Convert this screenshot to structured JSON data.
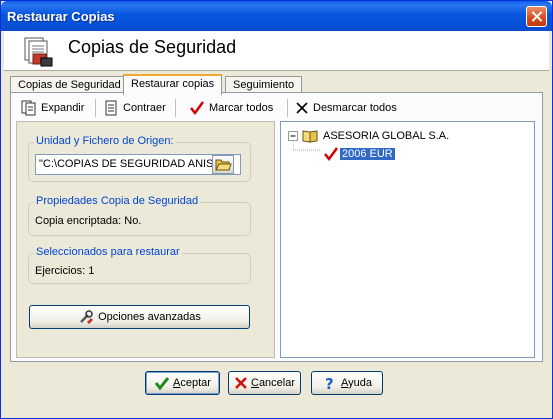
{
  "window": {
    "title": "Restaurar Copias"
  },
  "header": {
    "title": "Copias de Seguridad"
  },
  "tabs": [
    {
      "label": "Copias de Seguridad",
      "active": false
    },
    {
      "label": "Restaurar copias",
      "active": true
    },
    {
      "label": "Seguimiento",
      "active": false
    }
  ],
  "toolbar": {
    "expand": "Expandir",
    "collapse": "Contraer",
    "check_all": "Marcar todos",
    "uncheck_all": "Desmarcar todos"
  },
  "origin": {
    "label": "Unidad y Fichero de Origen:",
    "path": "\"C:\\COPIAS DE SEGURIDAD ANISO"
  },
  "properties": {
    "label": "Propiedades Copia de Seguridad",
    "encrypted_label": "Copia encriptada:",
    "encrypted_value": "No."
  },
  "selection": {
    "label": "Seleccionados para restaurar",
    "exercises_label": "Ejercicios:",
    "exercises_value": "1"
  },
  "advanced_button": "Opciones avanzadas",
  "tree": {
    "root": "ASESORIA GLOBAL S.A.",
    "child": "2006 EUR",
    "child_checked": true
  },
  "buttons": {
    "accept_u": "A",
    "accept_rest": "ceptar",
    "cancel_u": "C",
    "cancel_rest": "ancelar",
    "help_u": "A",
    "help_rest": "yuda"
  },
  "colors": {
    "titlebar": "#0856e0",
    "group_label": "#0046d5",
    "selection": "#316ac5",
    "check": "#d40000"
  }
}
